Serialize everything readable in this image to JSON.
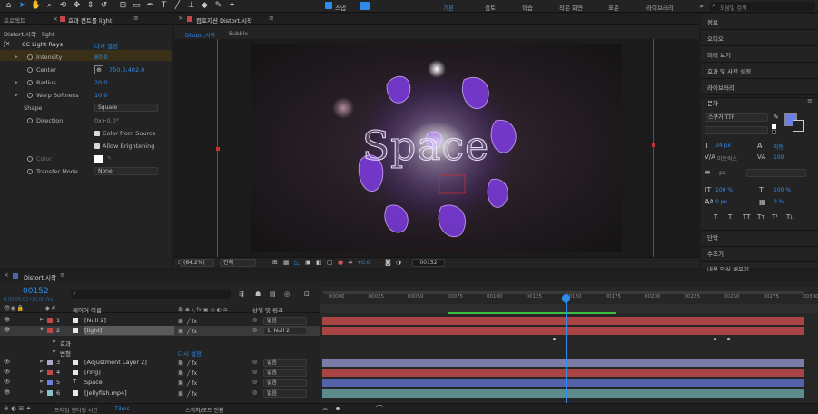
{
  "toolbar": {
    "tools": [
      {
        "icon": "home-icon",
        "glyph": "⌂"
      },
      {
        "icon": "selection-tool-icon",
        "glyph": "➤",
        "active": true
      },
      {
        "icon": "hand-tool-icon",
        "glyph": "✋"
      },
      {
        "icon": "zoom-tool-icon",
        "glyph": "⌕"
      },
      {
        "icon": "orbit-tool-icon",
        "glyph": "⟲"
      },
      {
        "icon": "pan-tool-icon",
        "glyph": "✥"
      },
      {
        "icon": "dolly-tool-icon",
        "glyph": "⇕"
      },
      {
        "icon": "rotate-tool-icon",
        "glyph": "↺"
      },
      {
        "icon": "anchor-tool-icon",
        "glyph": "⊞"
      },
      {
        "icon": "rectangle-tool-icon",
        "glyph": "▭"
      },
      {
        "icon": "pen-tool-icon",
        "glyph": "✒"
      },
      {
        "icon": "type-tool-icon",
        "glyph": "T"
      },
      {
        "icon": "brush-tool-icon",
        "glyph": "╱"
      },
      {
        "icon": "stamp-tool-icon",
        "glyph": "⊥"
      },
      {
        "icon": "eraser-tool-icon",
        "glyph": "◆"
      },
      {
        "icon": "roto-tool-icon",
        "glyph": "✎"
      },
      {
        "icon": "puppet-tool-icon",
        "glyph": "✦"
      }
    ],
    "snap_label": "스냅",
    "workspaces": [
      "기본",
      "검토",
      "학습",
      "작은 화면",
      "표준",
      "라이브러리"
    ],
    "active_workspace": "기본",
    "overflow": "»",
    "search_placeholder": "도움말 검색"
  },
  "effects_panel": {
    "tabs": [
      "프로젝트",
      "효과 컨트롤 light"
    ],
    "breadcrumb": "Distort.시작 · light",
    "effect_name": "CC Light Rays",
    "reset_label": "다시 설정",
    "properties": [
      {
        "label": "Intensity",
        "value": "80.0"
      },
      {
        "label": "Center",
        "value": "750.0,402.0"
      },
      {
        "label": "Radius",
        "value": "20.0"
      },
      {
        "label": "Warp Softness",
        "value": "10.0"
      },
      {
        "label": "Shape",
        "value": "Square"
      },
      {
        "label": "Direction",
        "value": "0x+0.0°"
      },
      {
        "label": "Color from Source",
        "value": ""
      },
      {
        "label": "Allow Brightening",
        "value": ""
      },
      {
        "label": "Color",
        "value": ""
      },
      {
        "label": "Transfer Mode",
        "value": "None"
      }
    ]
  },
  "composition": {
    "tab_label": "컴포지션 Distort.시작",
    "breadcrumbs": [
      "Distort.시작",
      "Bubble"
    ],
    "overlay_text": "Space",
    "zoom": "(64.2%)",
    "resolution": "전체",
    "exposure": "+0.0",
    "timecode": "00152"
  },
  "right_panels": {
    "items": [
      "정보",
      "오디오",
      "미리 보기",
      "효과 및 사전 설정",
      "라이브러리"
    ],
    "char_title": "문자",
    "font_name": "스쿠거 TTF",
    "font_size": "34 px",
    "leading_label": "자동",
    "kerning": "미트릭스",
    "tracking": "100",
    "stroke": "- px",
    "vscale": "100 %",
    "hscale": "100 %",
    "baseline": "0 px",
    "tsume": "0 %",
    "style_buttons": [
      "T",
      "T",
      "TT",
      "Tт",
      "T¹",
      "T₁"
    ],
    "lower_items": [
      "단락",
      "수조기",
      "내용 인식 채우기"
    ],
    "fill_color": "#6b7fe6"
  },
  "timeline": {
    "tab_label": "Distort.시작",
    "timecode": "00152",
    "timecode_sub": "0:00:05:02 (30.00 fps)",
    "search_placeholder": "",
    "col_source": "레이어 이름",
    "col_parent": "상위 및 링크",
    "ruler_labels": [
      "00000",
      "00025",
      "00050",
      "00075",
      "00100",
      "00125",
      "00150",
      "00175",
      "00200",
      "00225",
      "00250",
      "00275",
      "00300"
    ],
    "layers": [
      {
        "num": "1",
        "name": "[Null 2]",
        "color": "#c24848",
        "parent": "없음"
      },
      {
        "num": "2",
        "name": "[light]",
        "color": "#c24848",
        "parent": "1. Null 2"
      },
      {
        "num": "3",
        "name": "[Adjustment Layer 2]",
        "color": "#a8a8c8",
        "parent": "없음"
      },
      {
        "num": "4",
        "name": "[ring]",
        "color": "#c24848",
        "parent": "없음"
      },
      {
        "num": "5",
        "name": "Space",
        "color": "#6b7fe6",
        "parent": "없음"
      },
      {
        "num": "6",
        "name": "[Jellyfish.mp4]",
        "color": "#8bc4c4",
        "parent": "없음"
      }
    ],
    "sub_rows": [
      {
        "label": "효과",
        "value": ""
      },
      {
        "label": "변형",
        "value": "다시 설정"
      }
    ],
    "footer_render_label": "프레임 렌더링 시간",
    "footer_render_value": "73ms",
    "footer_switch_label": "스위치/모드 전환"
  },
  "colors": {
    "accent": "#2d8ceb",
    "layer_red": "#a94444",
    "layer_purple": "#7c7ca8",
    "layer_blue": "#5561a8",
    "layer_teal": "#5e8c8c"
  }
}
